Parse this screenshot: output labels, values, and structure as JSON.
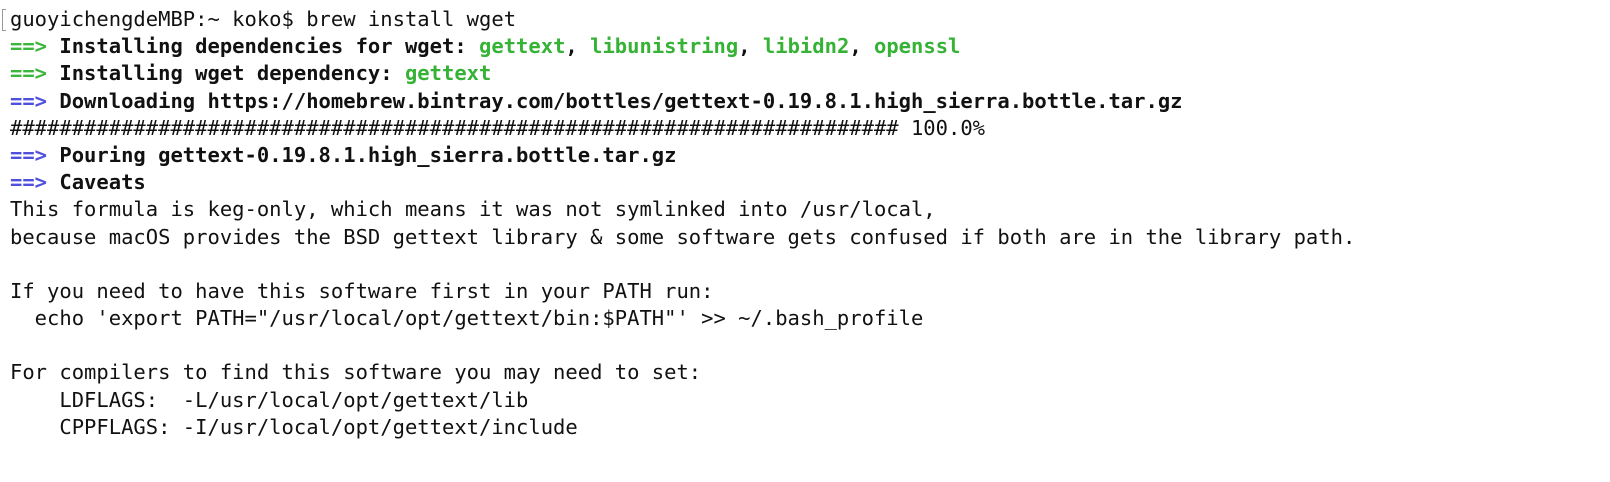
{
  "terminal": {
    "prompt": "guoyichengdeMBP:~ koko$ ",
    "command": "brew install wget",
    "arrow": "==>",
    "line2": {
      "label": " Installing dependencies for wget: ",
      "deps": [
        "gettext",
        "libunistring",
        "libidn2",
        "openssl"
      ],
      "sep": ", "
    },
    "line3": {
      "label": " Installing wget dependency: ",
      "dep": "gettext"
    },
    "line4": " Downloading https://homebrew.bintray.com/bottles/gettext-0.19.8.1.high_sierra.bottle.tar.gz",
    "line5": "######################################################################## 100.0%",
    "line6": " Pouring gettext-0.19.8.1.high_sierra.bottle.tar.gz",
    "line7": " Caveats",
    "line8": "This formula is keg-only, which means it was not symlinked into /usr/local,",
    "line9": "because macOS provides the BSD gettext library & some software gets confused if both are in the library path.",
    "line10": "",
    "line11": "If you need to have this software first in your PATH run:",
    "line12": "  echo 'export PATH=\"/usr/local/opt/gettext/bin:$PATH\"' >> ~/.bash_profile",
    "line13": "",
    "line14": "For compilers to find this software you may need to set:",
    "line15": "    LDFLAGS:  -L/usr/local/opt/gettext/lib",
    "line16": "    CPPFLAGS: -I/usr/local/opt/gettext/include"
  },
  "colors": {
    "green_arrow": "#3cb53c",
    "blue_arrow": "#5050e0",
    "package_green": "#36b336",
    "text": "#111111",
    "background": "#ffffff"
  }
}
